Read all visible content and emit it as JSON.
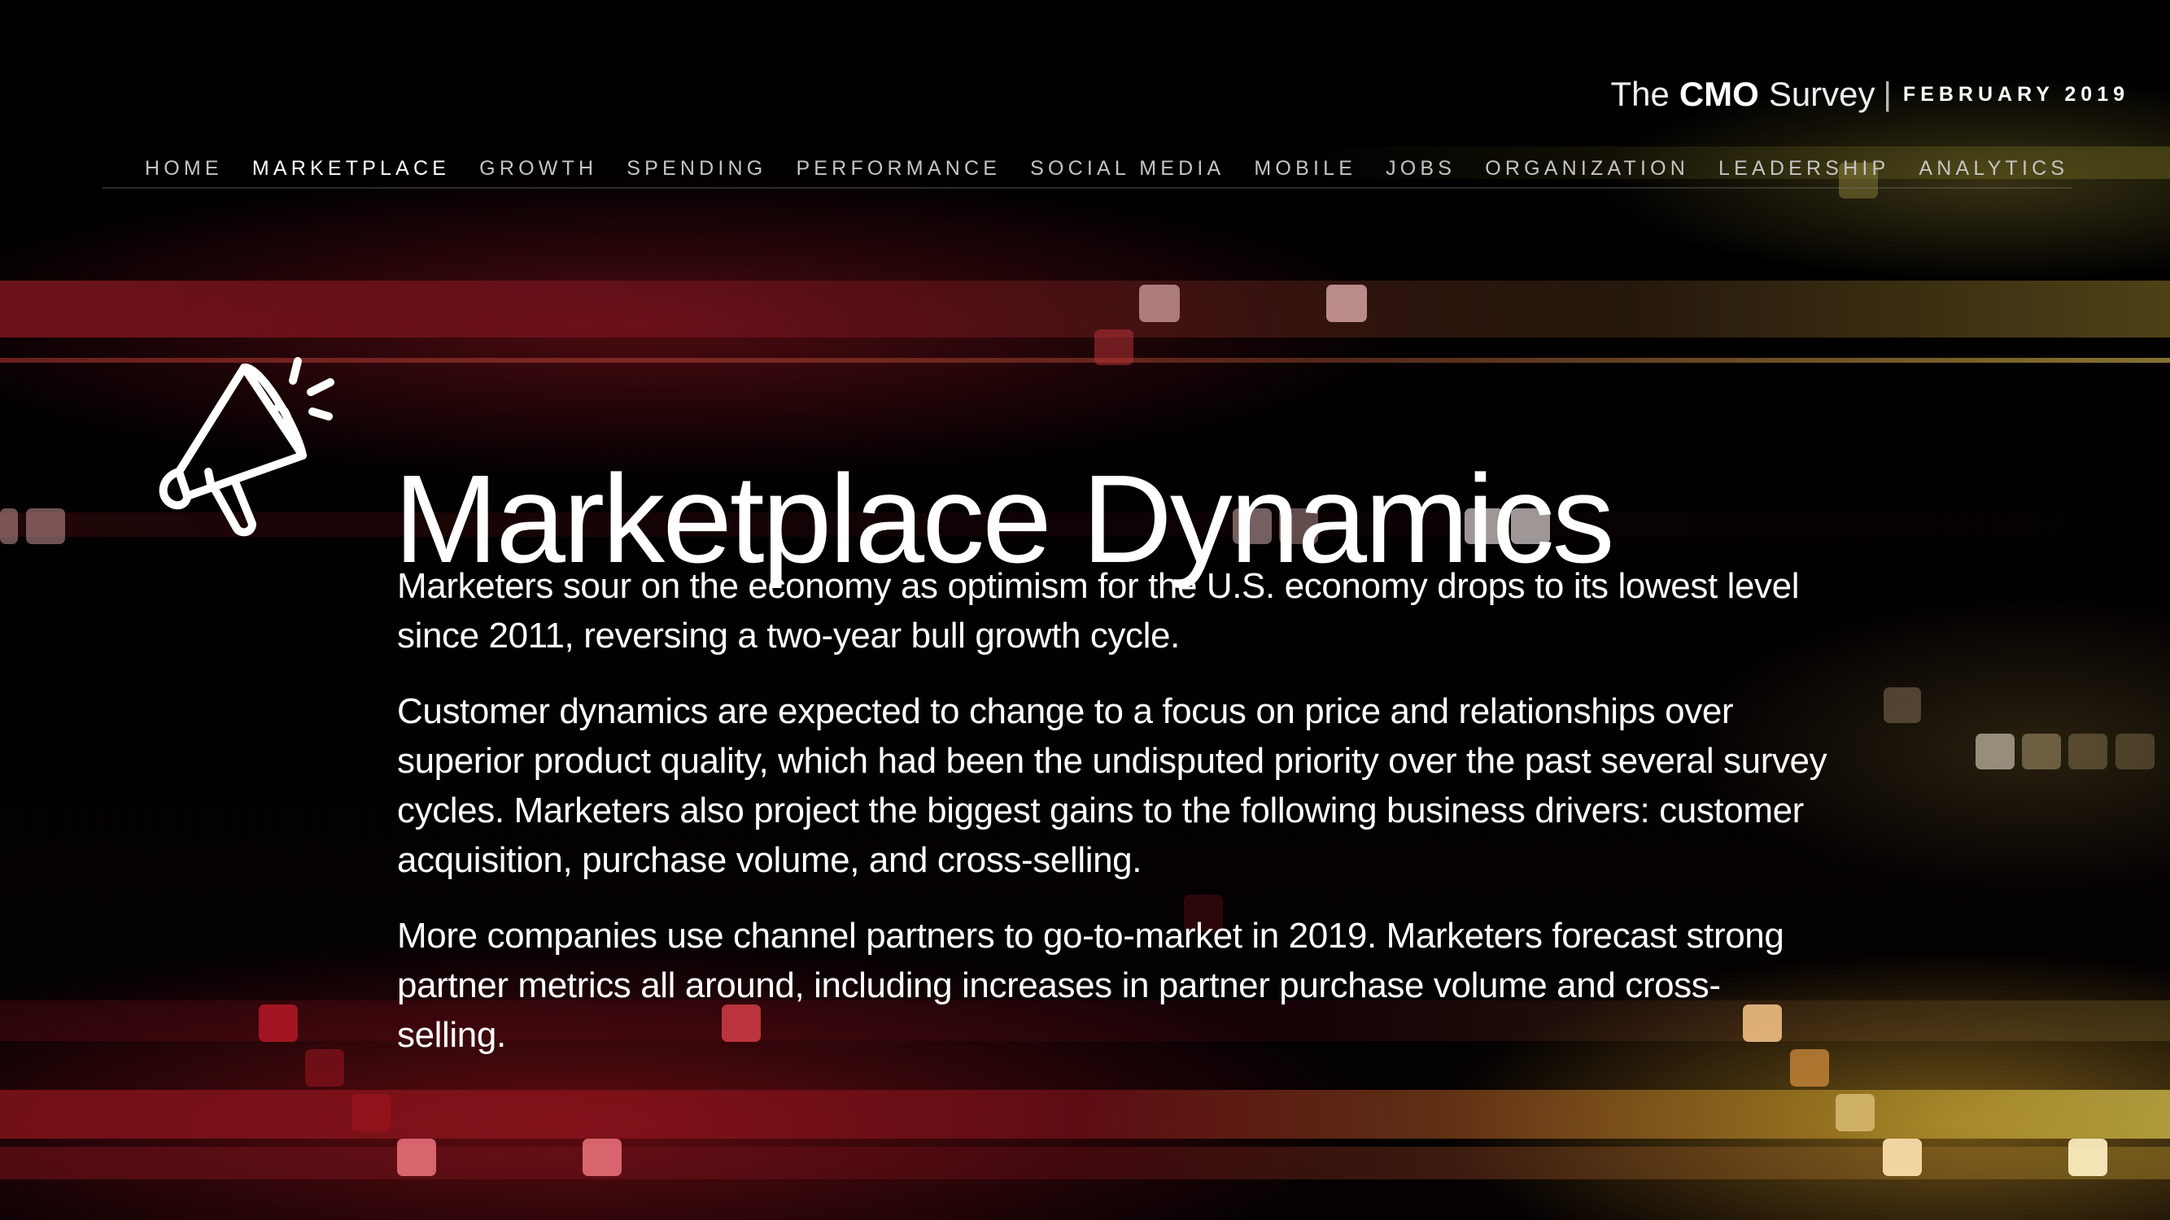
{
  "brand": {
    "prefix": "The",
    "name": "CMO",
    "suffix": "Survey",
    "separator": "|",
    "date": "FEBRUARY 2019"
  },
  "nav": {
    "items": [
      "HOME",
      "MARKETPLACE",
      "GROWTH",
      "SPENDING",
      "PERFORMANCE",
      "SOCIAL MEDIA",
      "MOBILE",
      "JOBS",
      "ORGANIZATION",
      "LEADERSHIP",
      "ANALYTICS"
    ],
    "active": "MARKETPLACE"
  },
  "page": {
    "icon": "megaphone-icon",
    "title": "Marketplace Dynamics",
    "paragraphs": [
      "Marketers sour on the economy as optimism for the U.S. economy drops to its lowest level since 2011, reversing a two-year bull growth cycle.",
      "Customer dynamics are expected to change to a focus on price and relationships over superior product quality, which had been the undisputed priority over the past several survey cycles. Marketers also project the biggest gains to the following business drivers: customer acquisition, purchase volume, and cross-selling.",
      "More companies use channel partners to go-to-market in 2019. Marketers forecast strong partner metrics all around, including increases in partner purchase volume and cross-selling."
    ]
  },
  "colors": {
    "background": "#000000",
    "accent_red": "#b3121e",
    "accent_gold": "#d9b040",
    "nav_text": "#c4c4c4",
    "text": "#ffffff"
  }
}
